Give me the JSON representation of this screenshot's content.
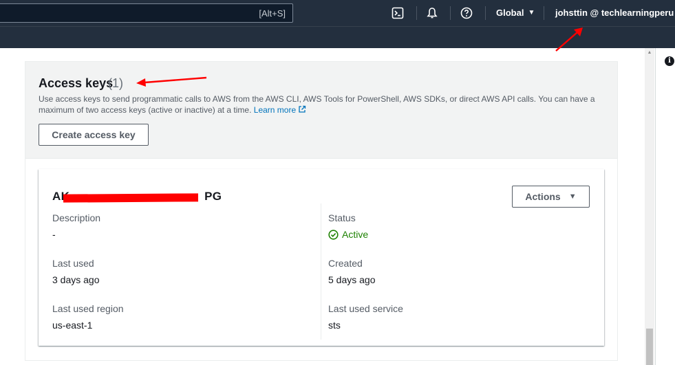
{
  "topbar": {
    "search_shortcut": "[Alt+S]",
    "region_label": "Global",
    "account_label": "johsttin @ techlearningperu"
  },
  "access_keys": {
    "title": "Access keys",
    "count": "(1)",
    "description": "Use access keys to send programmatic calls to AWS from the AWS CLI, AWS Tools for PowerShell, AWS SDKs, or direct AWS API calls. You can have a maximum of two access keys (active or inactive) at a time.",
    "learn_more": "Learn more",
    "create_button": "Create access key"
  },
  "key": {
    "id_prefix": "AK",
    "id_suffix": "PG",
    "actions_button": "Actions",
    "fields": {
      "description_label": "Description",
      "description_value": "-",
      "status_label": "Status",
      "status_value": "Active",
      "last_used_label": "Last used",
      "last_used_value": "3 days ago",
      "created_label": "Created",
      "created_value": "5 days ago",
      "last_used_region_label": "Last used region",
      "last_used_region_value": "us-east-1",
      "last_used_service_label": "Last used service",
      "last_used_service_value": "sts"
    }
  },
  "colors": {
    "nav_background": "#232f3e",
    "link": "#0073bb",
    "status_active": "#1d8102",
    "annotation": "#ff0000"
  },
  "icons": {
    "cloudshell": "terminal-icon",
    "notifications": "bell-icon",
    "support": "help-icon",
    "info": "info-icon",
    "external_link": "external-link-icon",
    "status": "check-circle-icon"
  }
}
